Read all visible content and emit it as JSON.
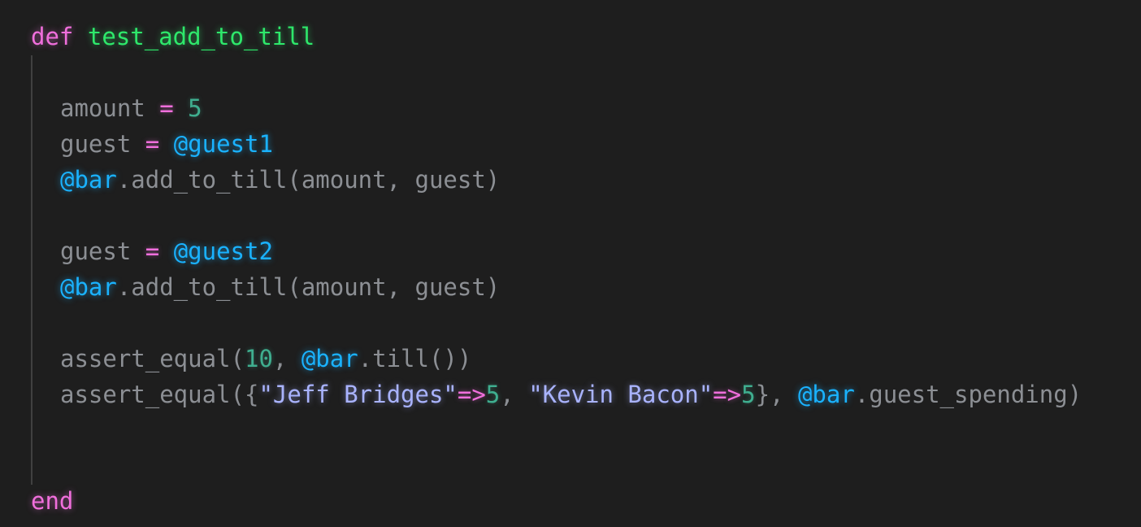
{
  "code": {
    "line1": {
      "kw": "def",
      "space": " ",
      "fn": "test_add_to_till"
    },
    "line2": {
      "var": "amount",
      "op": " = ",
      "num": "5"
    },
    "line3": {
      "var": "guest",
      "op": " = ",
      "ivar": "@guest1"
    },
    "line4": {
      "ivar": "@bar",
      "rest": ".add_to_till(amount, guest)"
    },
    "line5": {
      "var": "guest",
      "op": " = ",
      "ivar": "@guest2"
    },
    "line6": {
      "ivar": "@bar",
      "rest": ".add_to_till(amount, guest)"
    },
    "line7": {
      "pre": "assert_equal(",
      "num": "10",
      "mid": ", ",
      "ivar": "@bar",
      "post": ".till())"
    },
    "line8": {
      "pre": "assert_equal({",
      "str1": "\"Jeff Bridges\"",
      "arrow1": "=>",
      "num1": "5",
      "sep": ", ",
      "str2": "\"Kevin Bacon\"",
      "arrow2": "=>",
      "num2": "5",
      "close": "}, ",
      "ivar": "@bar",
      "post": ".guest_spending)"
    },
    "line9": {
      "kw": "end"
    }
  },
  "colors": {
    "background": "#1e1e1e",
    "keyword": "#f06fdc",
    "function_name": "#2ee86b",
    "instance_variable": "#1ab2ff",
    "number": "#3fae8f",
    "string": "#a9b3ff",
    "plain": "#8c8f94"
  }
}
